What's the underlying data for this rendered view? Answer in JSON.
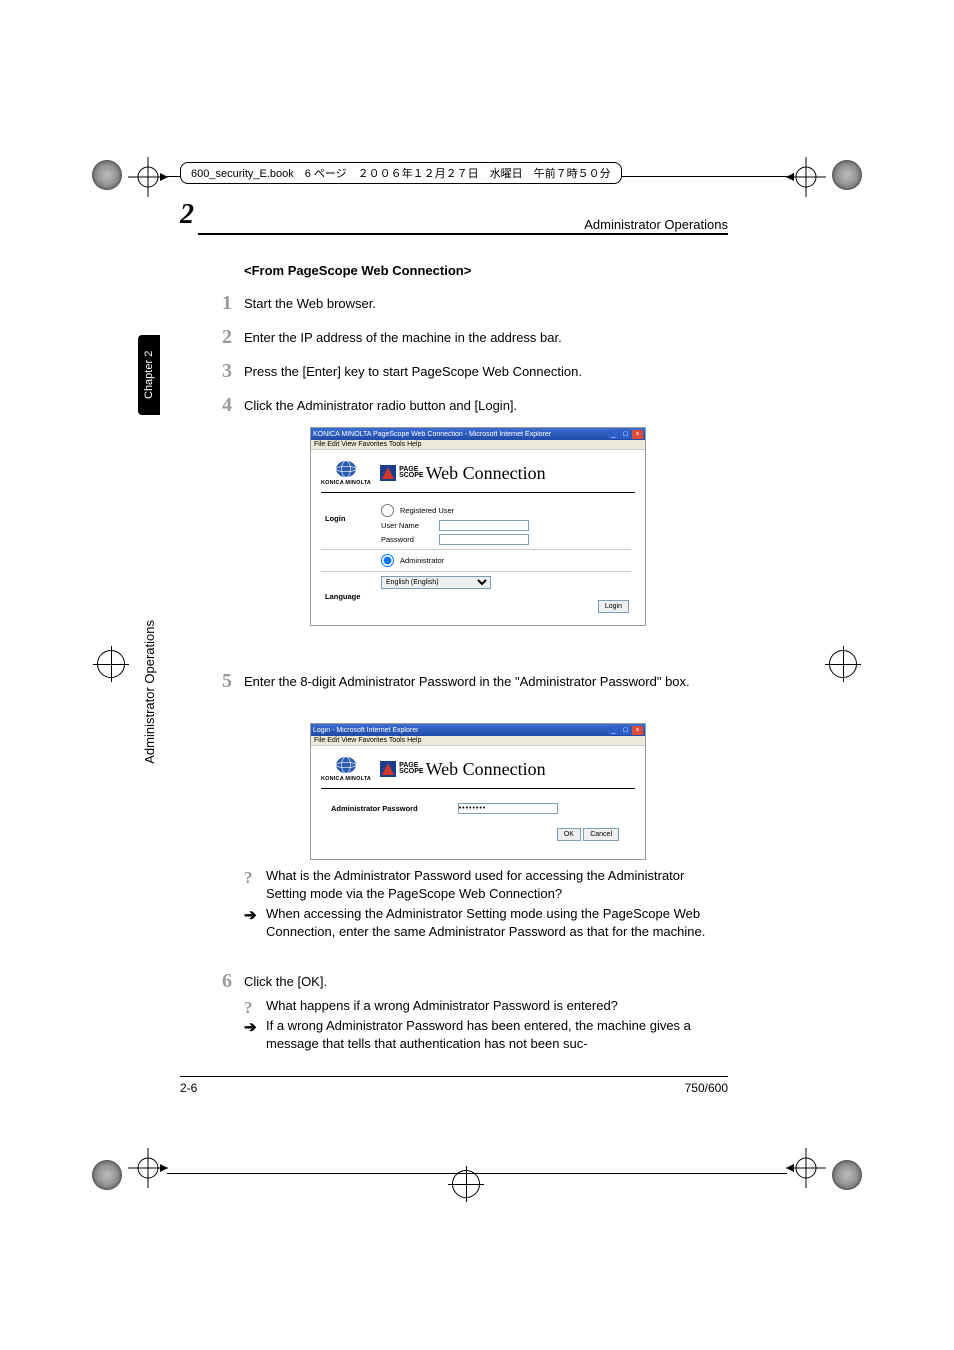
{
  "print_header": "600_security_E.book　6 ページ　２００６年１２月２７日　水曜日　午前７時５０分",
  "running_head": "Administrator Operations",
  "chapter_number": "2",
  "side_tab": "Chapter 2",
  "side_label": "Administrator Operations",
  "section_heading": "<From PageScope Web Connection>",
  "steps": {
    "s1": {
      "num": "1",
      "text": "Start the Web browser."
    },
    "s2": {
      "num": "2",
      "text": "Enter the IP address of the machine in the address bar."
    },
    "s3": {
      "num": "3",
      "text": "Press the [Enter] key to start PageScope Web Connection."
    },
    "s4": {
      "num": "4",
      "text": "Click the Administrator radio button and [Login]."
    },
    "s5": {
      "num": "5",
      "text": "Enter the 8-digit Administrator Password in the \"Administrator Password\" box."
    },
    "s6": {
      "num": "6",
      "text": "Click the [OK]."
    }
  },
  "screenshot1": {
    "title": "KONICA MINOLTA PageScope Web Connection - Microsoft Internet Explorer",
    "menubar": "File   Edit   View   Favorites   Tools   Help",
    "km_text": "KONICA MINOLTA",
    "ps_small_top": "PAGE",
    "ps_small_bot": "SCOPE",
    "ps_word": "Web Connection",
    "login_label": "Login",
    "reg_user": "Registered User",
    "user_name_lbl": "User Name",
    "password_lbl": "Password",
    "admin_lbl": "Administrator",
    "language_label": "Language",
    "language_value": "English (English)",
    "login_btn": "Login"
  },
  "screenshot2": {
    "title": "Login - Microsoft Internet Explorer",
    "menubar": "File   Edit   View   Favorites   Tools   Help",
    "admin_pw_label": "Administrator Password",
    "pw_value": "••••••••",
    "ok_btn": "OK",
    "cancel_btn": "Cancel"
  },
  "qa1": {
    "q": "What is the Administrator Password used for accessing the Administrator Setting mode via the PageScope Web Connection?",
    "a": "When accessing the Administrator Setting mode using the PageScope Web Connection, enter the same Administrator Password as that for the machine."
  },
  "qa2": {
    "q": "What happens if a wrong Administrator Password is entered?",
    "a": "If a wrong Administrator Password has been entered, the machine gives a message that tells that authentication has not been suc-"
  },
  "footer": {
    "left": "2-6",
    "right": "750/600"
  }
}
